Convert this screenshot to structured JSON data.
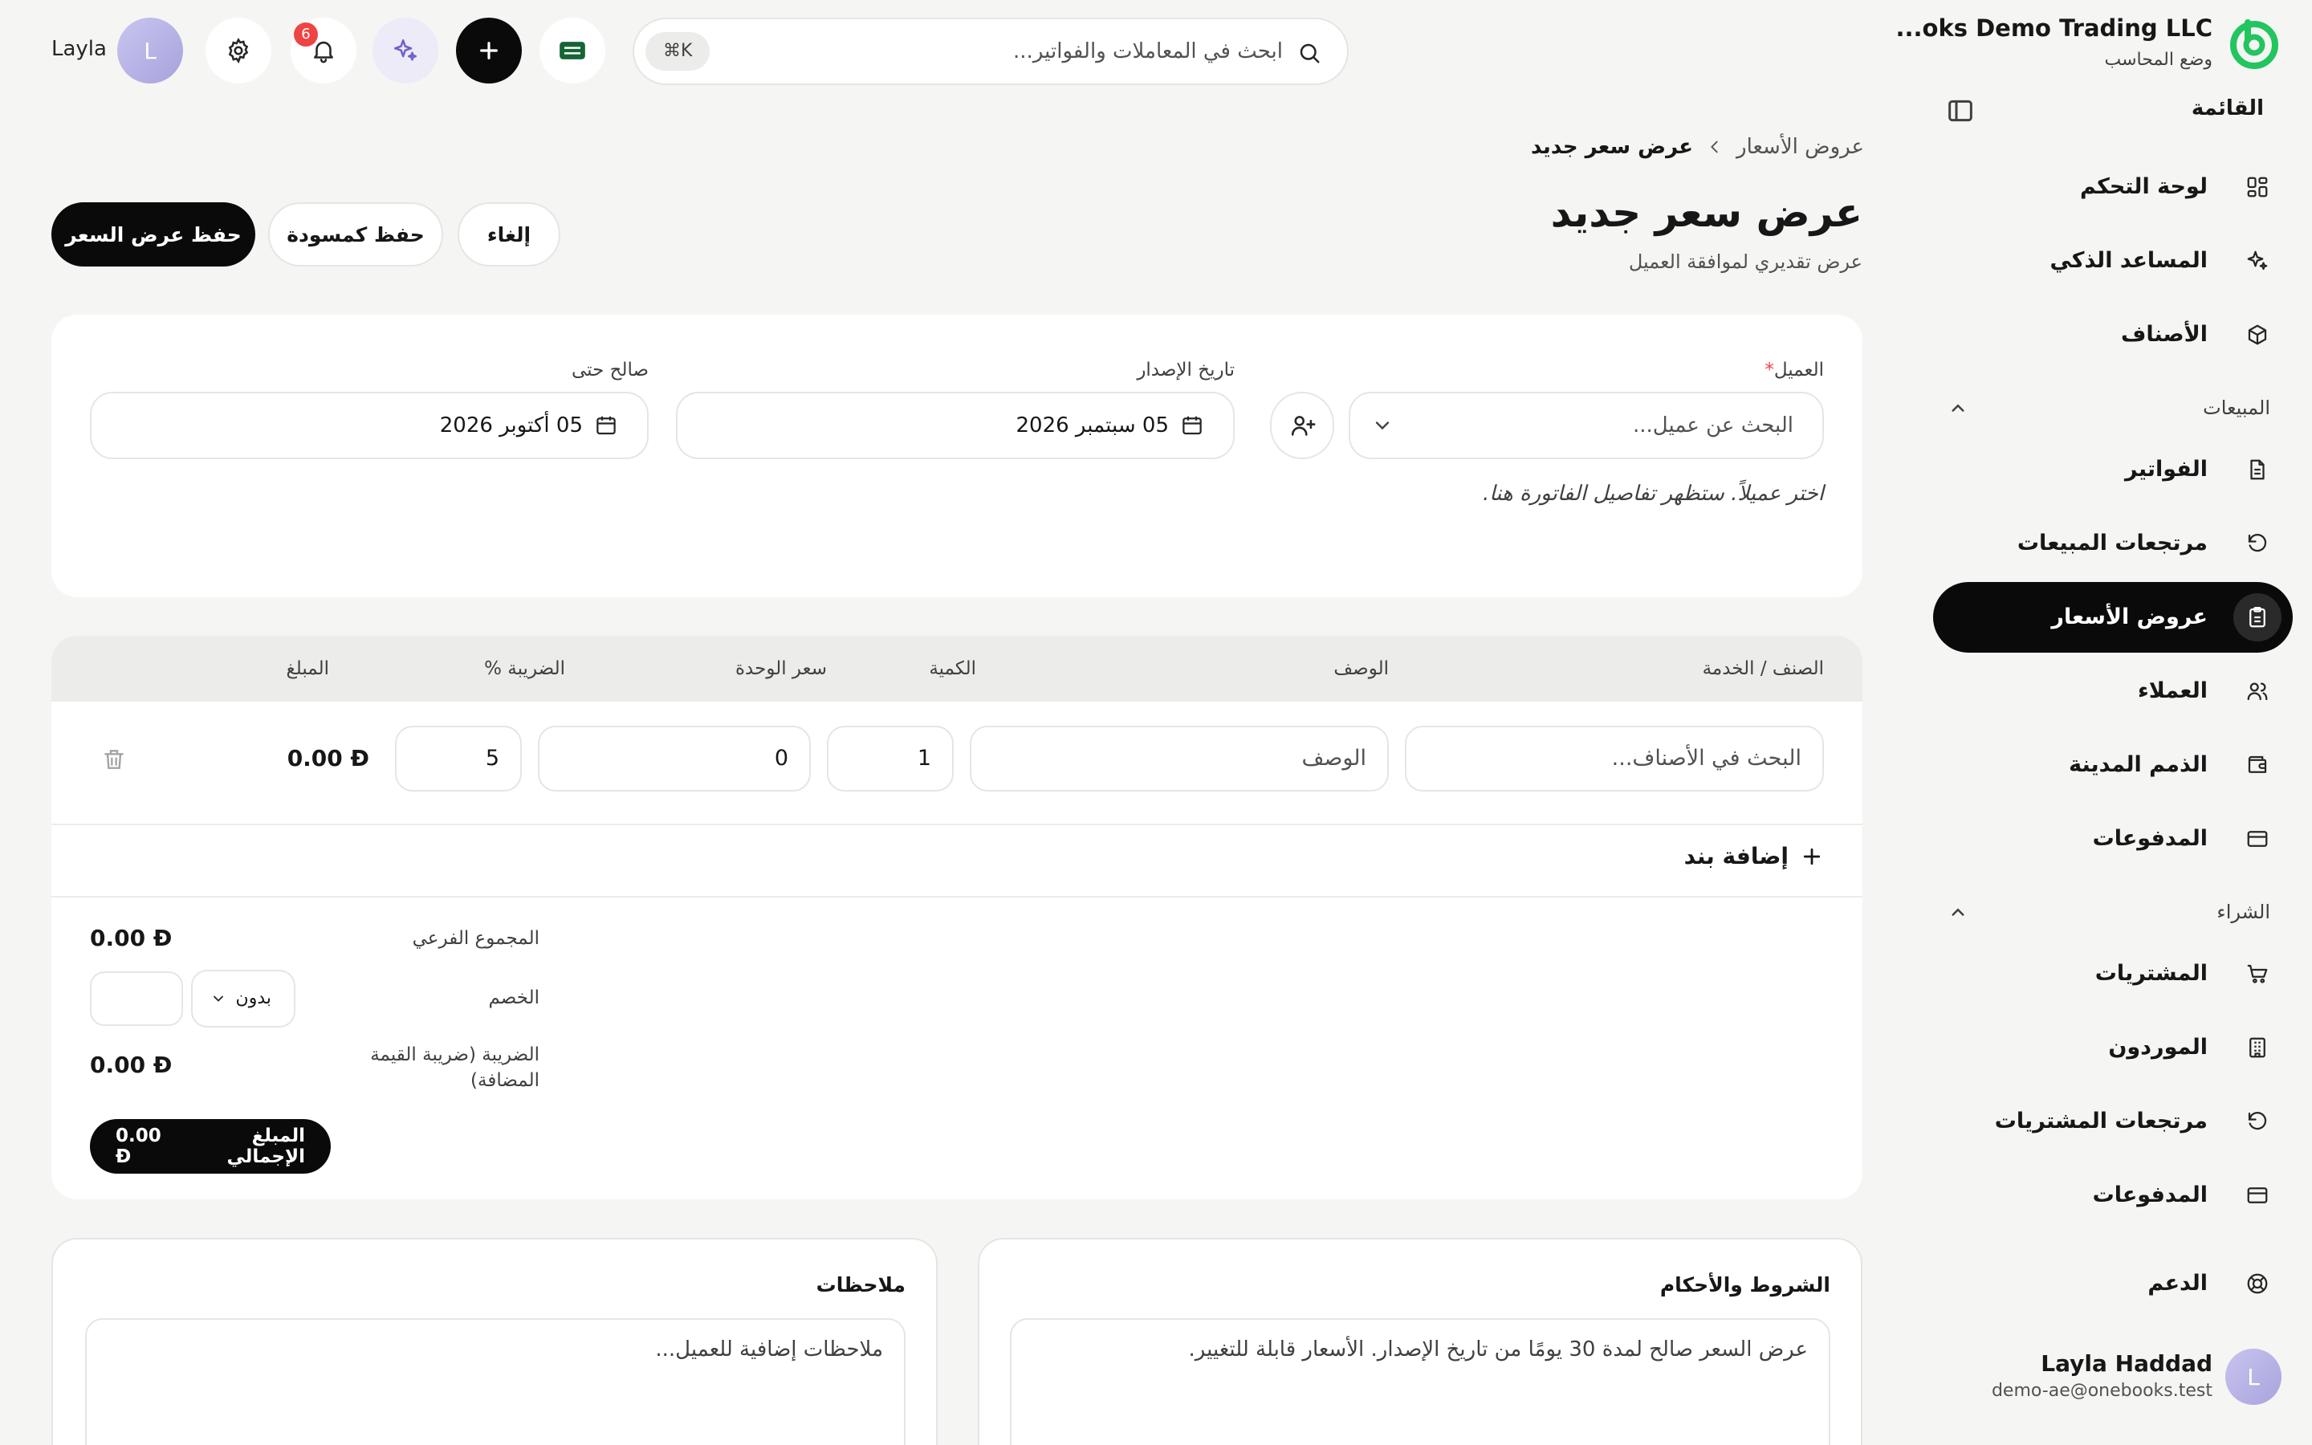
{
  "brand": {
    "name": "...oks Demo Trading LLC",
    "mode": "وضع المحاسب"
  },
  "sidebar": {
    "menu_title": "القائمة",
    "items": [
      {
        "label": "لوحة التحكم",
        "icon": "dashboard-icon"
      },
      {
        "label": "المساعد الذكي",
        "icon": "sparkles-icon"
      },
      {
        "label": "الأصناف",
        "icon": "box-icon"
      }
    ],
    "sales_title": "المبيعات",
    "sales_items": [
      {
        "label": "الفواتير",
        "icon": "file-text-icon"
      },
      {
        "label": "مرتجعات المبيعات",
        "icon": "rotate-ccw-icon"
      },
      {
        "label": "عروض الأسعار",
        "icon": "clipboard-icon",
        "active": true
      },
      {
        "label": "العملاء",
        "icon": "users-icon"
      },
      {
        "label": "الذمم المدينة",
        "icon": "wallet-icon"
      },
      {
        "label": "المدفوعات",
        "icon": "credit-card-icon"
      }
    ],
    "purchase_title": "الشراء",
    "purchase_items": [
      {
        "label": "المشتريات",
        "icon": "cart-icon"
      },
      {
        "label": "الموردون",
        "icon": "building-icon"
      },
      {
        "label": "مرتجعات المشتريات",
        "icon": "rotate-ccw-icon"
      },
      {
        "label": "المدفوعات",
        "icon": "credit-card-icon"
      }
    ],
    "support": {
      "label": "الدعم",
      "icon": "lifebuoy-icon"
    },
    "user": {
      "initial": "L",
      "name": "Layla Haddad",
      "email": "demo-ae@onebooks.test"
    }
  },
  "topbar": {
    "search_placeholder": "ابحث في المعاملات والفواتير...",
    "shortcut": "⌘K",
    "notifications_count": "6",
    "user_initial": "L",
    "username": "Layla"
  },
  "header": {
    "breadcrumb_parent": "عروض الأسعار",
    "breadcrumb_current": "عرض سعر جديد",
    "title": "عرض سعر جديد",
    "subtitle": "عرض تقديري لموافقة العميل",
    "save_label": "حفظ عرض السعر",
    "draft_label": "حفظ كمسودة",
    "cancel_label": "إلغاء"
  },
  "customer_card": {
    "customer_label": "العميل",
    "customer_required": "*",
    "customer_placeholder": "البحث عن عميل...",
    "issue_date_label": "تاريخ الإصدار",
    "issue_date": "05 سبتمبر 2026",
    "valid_until_label": "صالح حتى",
    "valid_until": "05 أكتوبر 2026",
    "hint": "اختر عميلاً. ستظهر تفاصيل الفاتورة هنا."
  },
  "items_table": {
    "headers": {
      "item": "الصنف / الخدمة",
      "description": "الوصف",
      "qty": "الكمية",
      "unit_price": "سعر الوحدة",
      "tax": "الضريبة %",
      "amount": "المبلغ"
    },
    "row": {
      "item_placeholder": "البحث في الأصناف...",
      "description_placeholder": "الوصف",
      "qty": "1",
      "unit_price": "0",
      "tax": "5",
      "amount": "0.00"
    },
    "add_line_label": "إضافة بند"
  },
  "totals": {
    "currency_symbol": "Ð",
    "subtotal_label": "المجموع الفرعي",
    "subtotal": "0.00",
    "discount_label": "الخصم",
    "discount_type": "بدون",
    "tax_label": "الضريبة (ضريبة القيمة المضافة)",
    "tax": "0.00",
    "grand_total_label": "المبلغ الإجمالي",
    "grand_total": "0.00"
  },
  "terms": {
    "title": "الشروط والأحكام",
    "text": "عرض السعر صالح لمدة 30 يومًا من تاريخ الإصدار. الأسعار قابلة للتغيير."
  },
  "notes": {
    "title": "ملاحظات",
    "placeholder": "ملاحظات إضافية للعميل..."
  },
  "colors": {
    "accent": "#0a0a0a",
    "brand_green": "#22c55e",
    "badge": "#ef4444",
    "background": "#f5f5f4"
  }
}
